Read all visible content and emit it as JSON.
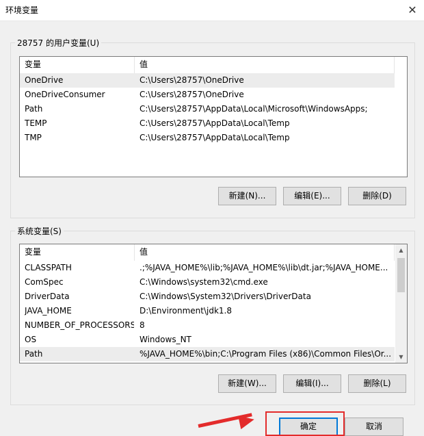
{
  "window": {
    "title": "环境变量",
    "close_icon": "close-icon"
  },
  "user_vars": {
    "legend": "28757 的用户变量(U)",
    "columns": [
      "变量",
      "值"
    ],
    "rows": [
      {
        "name": "OneDrive",
        "value": "C:\\Users\\28757\\OneDrive"
      },
      {
        "name": "OneDriveConsumer",
        "value": "C:\\Users\\28757\\OneDrive"
      },
      {
        "name": "Path",
        "value": "C:\\Users\\28757\\AppData\\Local\\Microsoft\\WindowsApps;"
      },
      {
        "name": "TEMP",
        "value": "C:\\Users\\28757\\AppData\\Local\\Temp"
      },
      {
        "name": "TMP",
        "value": "C:\\Users\\28757\\AppData\\Local\\Temp"
      }
    ],
    "buttons": {
      "new": "新建(N)...",
      "edit": "编辑(E)...",
      "delete": "删除(D)"
    }
  },
  "system_vars": {
    "legend": "系统变量(S)",
    "columns": [
      "变量",
      "值"
    ],
    "rows": [
      {
        "name": "CLASSPATH",
        "value": ".;%JAVA_HOME%\\lib;%JAVA_HOME%\\lib\\dt.jar;%JAVA_HOME..."
      },
      {
        "name": "ComSpec",
        "value": "C:\\Windows\\system32\\cmd.exe"
      },
      {
        "name": "DriverData",
        "value": "C:\\Windows\\System32\\Drivers\\DriverData"
      },
      {
        "name": "JAVA_HOME",
        "value": "D:\\Environment\\jdk1.8"
      },
      {
        "name": "NUMBER_OF_PROCESSORS",
        "value": "8"
      },
      {
        "name": "OS",
        "value": "Windows_NT"
      },
      {
        "name": "Path",
        "value": "%JAVA_HOME%\\bin;C:\\Program Files (x86)\\Common Files\\Or..."
      }
    ],
    "buttons": {
      "new": "新建(W)...",
      "edit": "编辑(I)...",
      "delete": "删除(L)"
    }
  },
  "footer": {
    "ok": "确定",
    "cancel": "取消"
  },
  "colors": {
    "annotation": "#e32b2b",
    "focus": "#0078d7"
  }
}
